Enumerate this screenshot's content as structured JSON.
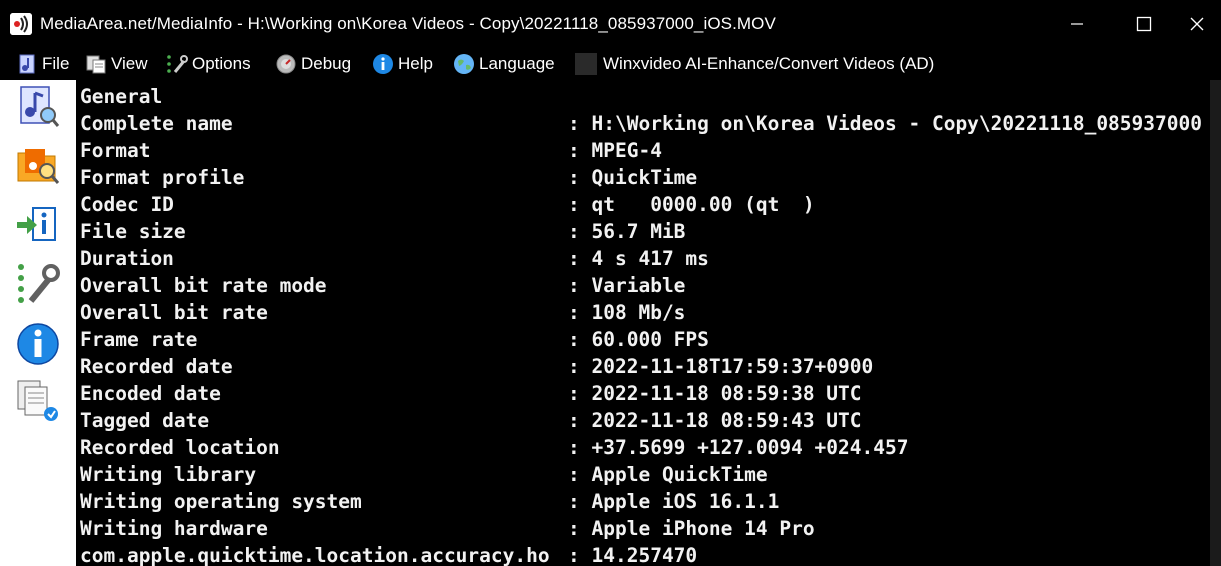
{
  "window": {
    "title": "MediaArea.net/MediaInfo - H:\\Working on\\Korea Videos - Copy\\20221118_085937000_iOS.MOV"
  },
  "menu": {
    "items": [
      {
        "label": "File",
        "icon": "file-music-icon"
      },
      {
        "label": "View",
        "icon": "view-icon"
      },
      {
        "label": "Options",
        "icon": "options-icon"
      },
      {
        "label": "Debug",
        "icon": "debug-icon"
      },
      {
        "label": "Help",
        "icon": "help-icon"
      },
      {
        "label": "Language",
        "icon": "globe-icon"
      }
    ],
    "ad_label": "Winxvideo AI-Enhance/Convert Videos (AD)"
  },
  "sidebar": {
    "buttons": [
      "open-file-icon",
      "open-folder-icon",
      "export-icon",
      "preferences-icon",
      "about-icon",
      "sheet-view-icon"
    ]
  },
  "report": {
    "section": "General",
    "rows": [
      {
        "label": "Complete name",
        "value": "H:\\Working on\\Korea Videos - Copy\\20221118_085937000"
      },
      {
        "label": "Format",
        "value": "MPEG-4"
      },
      {
        "label": "Format profile",
        "value": "QuickTime"
      },
      {
        "label": "Codec ID",
        "value": "qt   0000.00 (qt  )"
      },
      {
        "label": "File size",
        "value": "56.7 MiB"
      },
      {
        "label": "Duration",
        "value": "4 s 417 ms"
      },
      {
        "label": "Overall bit rate mode",
        "value": "Variable"
      },
      {
        "label": "Overall bit rate",
        "value": "108 Mb/s"
      },
      {
        "label": "Frame rate",
        "value": "60.000 FPS"
      },
      {
        "label": "Recorded date",
        "value": "2022-11-18T17:59:37+0900"
      },
      {
        "label": "Encoded date",
        "value": "2022-11-18 08:59:38 UTC"
      },
      {
        "label": "Tagged date",
        "value": "2022-11-18 08:59:43 UTC"
      },
      {
        "label": "Recorded location",
        "value": "+37.5699 +127.0094 +024.457"
      },
      {
        "label": "Writing library",
        "value": "Apple QuickTime"
      },
      {
        "label": "Writing operating system",
        "value": "Apple iOS 16.1.1"
      },
      {
        "label": "Writing hardware",
        "value": "Apple iPhone 14 Pro"
      },
      {
        "label": "com.apple.quicktime.location.accuracy.ho",
        "value": "14.257470"
      }
    ],
    "separator": ":"
  }
}
